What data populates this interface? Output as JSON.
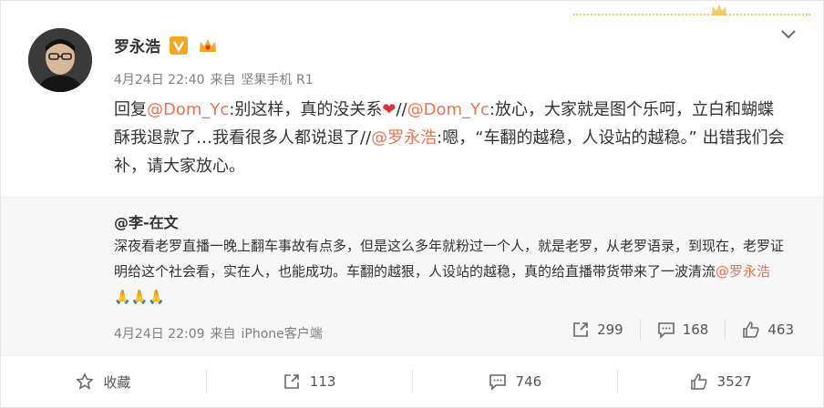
{
  "post": {
    "author": "罗永浩",
    "time": "4月24日 22:40",
    "source_prefix": "来自",
    "source": "坚果手机 R1",
    "content": {
      "p1": "回复",
      "m1": "@Dom_Yc",
      "t1": ":别这样，真的没关系",
      "heart": "❤",
      "t2": "//",
      "m2": "@Dom_Yc",
      "t3": ":放心，大家就是图个乐呵，立白和蝴蝶酥我退款了…我看很多人都说退了//",
      "m3": "@罗永浩",
      "t4": ":嗯，“车翻的越稳，人设站的越稳。” 出错我们会补，请大家放心。"
    }
  },
  "repost": {
    "user": "@李-在文",
    "text_before": "深夜看老罗直播一晚上翻车事故有点多，但是这么多年就粉过一个人，就是老罗，从老罗语录，到现在，老罗证明给这个社会看，实在人，也能成功。车翻的越狠，人设站的越稳，真的给直播带货带来了一波清流",
    "mention": "@罗永浩",
    "emoji": "🙏🙏🙏",
    "time": "4月24日 22:09",
    "source_prefix": "来自",
    "source": "iPhone客户端",
    "shares": "299",
    "comments": "168",
    "likes": "463"
  },
  "actions": {
    "favorite": "收藏",
    "shares": "113",
    "comments": "746",
    "likes": "3527"
  },
  "colors": {
    "link": "#eb7350",
    "badge": "#f5a623",
    "heart": "#e0313a"
  },
  "icons": [
    "chevron-down-icon",
    "verified-v-icon",
    "crown-icon",
    "share-icon",
    "comment-icon",
    "like-icon",
    "star-icon"
  ]
}
